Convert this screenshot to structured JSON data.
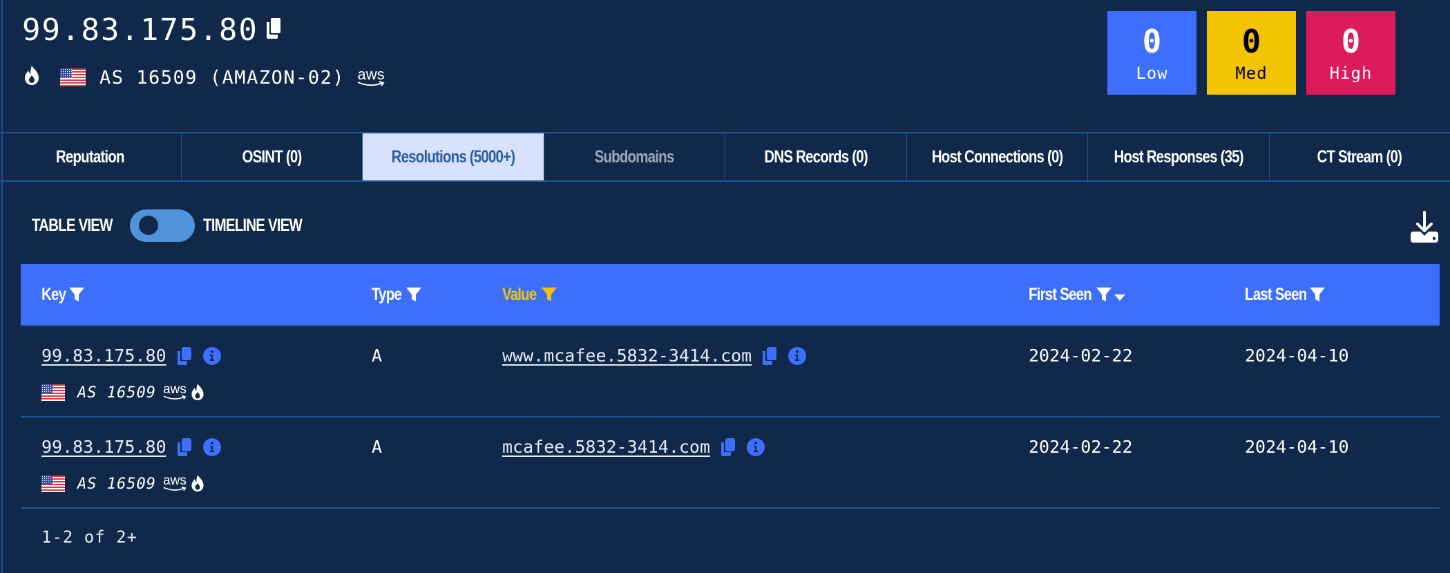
{
  "header": {
    "ip": "99.83.175.80",
    "asn_label": "AS 16509 (AMAZON-02)",
    "country": "US",
    "provider": "aws",
    "icons": [
      "fire-icon",
      "us-flag-icon",
      "aws-logo-icon",
      "copy-icon"
    ]
  },
  "severity": [
    {
      "count": "0",
      "label": "Low",
      "color": "#3d6ffc"
    },
    {
      "count": "0",
      "label": "Med",
      "color": "#f5c400"
    },
    {
      "count": "0",
      "label": "High",
      "color": "#de1b5a"
    }
  ],
  "tabs": [
    {
      "label": "Reputation",
      "state": "normal"
    },
    {
      "label": "OSINT (0)",
      "state": "normal"
    },
    {
      "label": "Resolutions (5000+)",
      "state": "active"
    },
    {
      "label": "Subdomains",
      "state": "disabled"
    },
    {
      "label": "DNS Records (0)",
      "state": "normal"
    },
    {
      "label": "Host Connections (0)",
      "state": "normal"
    },
    {
      "label": "Host Responses (35)",
      "state": "normal"
    },
    {
      "label": "CT Stream (0)",
      "state": "normal"
    }
  ],
  "view_toggle": {
    "left_label": "TABLE VIEW",
    "right_label": "TIMELINE VIEW",
    "selected": "TABLE VIEW"
  },
  "download_icon": "download-icon",
  "table": {
    "columns": [
      {
        "label": "Key",
        "filter_active": false
      },
      {
        "label": "Type",
        "filter_active": false
      },
      {
        "label": "Value",
        "filter_active": true
      },
      {
        "label": "First Seen",
        "filter_active": false,
        "sorted": "desc"
      },
      {
        "label": "Last Seen",
        "filter_active": false
      }
    ],
    "rows": [
      {
        "key": "99.83.175.80",
        "asn": "AS 16509",
        "type": "A",
        "value": "www.mcafee.5832-3414.com",
        "first_seen": "2024-02-22",
        "last_seen": "2024-04-10"
      },
      {
        "key": "99.83.175.80",
        "asn": "AS 16509",
        "type": "A",
        "value": "mcafee.5832-3414.com",
        "first_seen": "2024-02-22",
        "last_seen": "2024-04-10"
      }
    ]
  },
  "pagination": {
    "text": "1-2 of 2+"
  }
}
